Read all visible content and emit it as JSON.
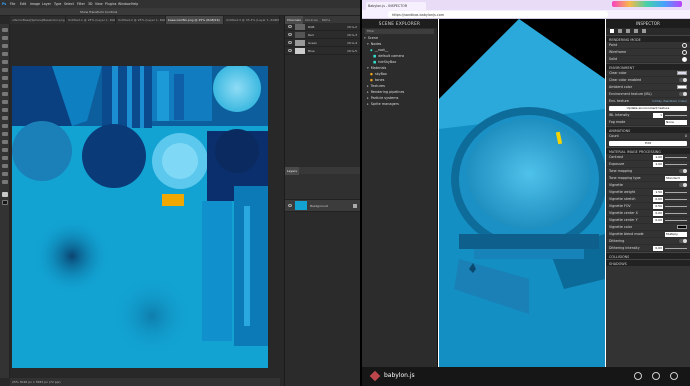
{
  "photoshop": {
    "menu": [
      "Ps",
      "File",
      "Edit",
      "Image",
      "Layer",
      "Type",
      "Select",
      "Filter",
      "3D",
      "View",
      "Plugins",
      "Window",
      "Help"
    ],
    "options_text": "Show Transform Controls",
    "doc_tabs": [
      {
        "label": "ulteriorBase[Sphere]BaseColor.png @ 50% (L",
        "active": false
      },
      {
        "label": "Untitled-1 @ 25% (Layer 1, RGB/8)",
        "active": false
      },
      {
        "label": "Untitled-2 @ 25% (Layer 1, RGB/8)",
        "active": false
      },
      {
        "label": "basecolorBG.png @ 25% (RGB/16)",
        "active": true
      },
      {
        "label": "Untitled-3 @ 33.3% (Layer 1, RGB/8)",
        "active": false
      }
    ],
    "status": "25%   3046 px x 3583 px (72 ppi)",
    "channels_tabs": [
      "Channels",
      "Libraries",
      "Paths"
    ],
    "channels": [
      {
        "name": "RGB",
        "shortcut": "Ctrl+2"
      },
      {
        "name": "Red",
        "shortcut": "Ctrl+3"
      },
      {
        "name": "Green",
        "shortcut": "Ctrl+4"
      },
      {
        "name": "Blue",
        "shortcut": "Ctrl+5"
      }
    ],
    "layers_title": "Layers",
    "layer_name": "Background"
  },
  "browser": {
    "tab_title": "Babylon.js - INSPECTOR",
    "url": "https://sandbox.babylonjs.com",
    "brand": "babylon.js",
    "accent": "#3a86c8"
  },
  "scene_explorer": {
    "title": "SCENE EXPLORER",
    "filter_placeholder": "Filter",
    "items": [
      {
        "label": "Scene",
        "indent": 0
      },
      {
        "label": "Nodes",
        "indent": 1
      },
      {
        "label": "__root__",
        "indent": 2
      },
      {
        "label": "default camera",
        "indent": 3
      },
      {
        "label": "hdrSkyBox",
        "indent": 3
      },
      {
        "label": "Materials",
        "indent": 1
      },
      {
        "label": "skyBox",
        "indent": 2
      },
      {
        "label": "tones",
        "indent": 2
      },
      {
        "label": "Textures",
        "indent": 1
      },
      {
        "label": "Rendering pipelines",
        "indent": 1
      },
      {
        "label": "Particle systems",
        "indent": 1
      },
      {
        "label": "Sprite managers",
        "indent": 1
      }
    ]
  },
  "inspector": {
    "title": "INSPECTOR",
    "rendering_mode": {
      "title": "RENDERING MODE",
      "options": [
        "Point",
        "Wireframe",
        "Solid"
      ],
      "selected": "Solid"
    },
    "environment": {
      "title": "ENVIRONMENT",
      "clear_color": "Clear color",
      "clear_color_enabled": "Clear color enabled",
      "ambient_color": "Ambient color",
      "env_texture_label": "Environment texture (IBL)",
      "env_texture": "Env. texture",
      "env_texture_value": "hdrSky (Sandbox) (cube)",
      "update_button": "Update environment texture",
      "ibl_intensity": "IBL Intensity",
      "ibl_value": "1",
      "fog_mode": "Fog mode",
      "fog_value": "None"
    },
    "animations": {
      "title": "ANIMATIONS",
      "count_label": "Count",
      "count_value": "0",
      "edit_button": "Edit"
    },
    "material_image": {
      "title": "MATERIAL IMAGE PROCESSING",
      "rows": [
        {
          "label": "Contrast",
          "value": "1.00"
        },
        {
          "label": "Exposure",
          "value": "1.00"
        },
        {
          "label": "Tone mapping",
          "value": ""
        },
        {
          "label": "Tone mapping type",
          "value": "Standard"
        },
        {
          "label": "Vignette",
          "value": ""
        },
        {
          "label": "Vignette weight",
          "value": "1.50"
        },
        {
          "label": "Vignette stretch",
          "value": "0.00"
        },
        {
          "label": "Vignette FOV",
          "value": "0.50"
        },
        {
          "label": "Vignette center X",
          "value": "0.00"
        },
        {
          "label": "Vignette center Y",
          "value": "0.00"
        },
        {
          "label": "Vignette color",
          "value": ""
        },
        {
          "label": "Vignette blend mode",
          "value": "Multiply"
        },
        {
          "label": "Dithering",
          "value": ""
        },
        {
          "label": "Dithering intensity",
          "value": "0.00"
        }
      ]
    },
    "collisions": "COLLISIONS",
    "shadows": "SHADOWS"
  }
}
